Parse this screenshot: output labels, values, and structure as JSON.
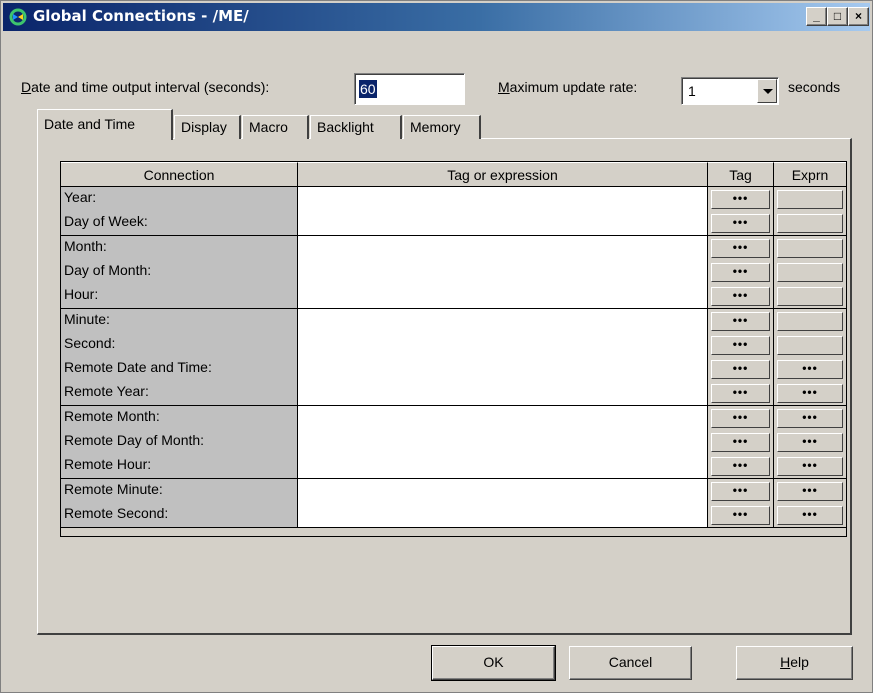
{
  "window": {
    "title": "Global Connections - /ME/",
    "minimize_glyph": "_",
    "maximize_glyph": "□",
    "close_glyph": "×"
  },
  "interval": {
    "label_key": "D",
    "label_rest": "ate and time output interval (seconds):",
    "value": "60"
  },
  "rate": {
    "label_key": "M",
    "label_rest": "aximum update rate:",
    "value": "1",
    "unit": "seconds"
  },
  "tabs": [
    {
      "label": "Date and Time",
      "active": true
    },
    {
      "label": "Display",
      "active": false
    },
    {
      "label": "Macro",
      "active": false
    },
    {
      "label": "Backlight",
      "active": false
    },
    {
      "label": "Memory",
      "active": false
    }
  ],
  "grid": {
    "headers": [
      "Connection",
      "Tag or expression",
      "Tag",
      "Exprn"
    ],
    "ellipsis": "•••",
    "rows": [
      {
        "connection": "Year:",
        "expr_button": false
      },
      {
        "connection": "Day of Week:",
        "expr_button": false
      },
      {
        "connection": "Month:",
        "expr_button": false
      },
      {
        "connection": "Day of Month:",
        "expr_button": false
      },
      {
        "connection": "Hour:",
        "expr_button": false
      },
      {
        "connection": "Minute:",
        "expr_button": false
      },
      {
        "connection": "Second:",
        "expr_button": false
      },
      {
        "connection": "Remote Date and Time:",
        "expr_button": true
      },
      {
        "connection": "Remote Year:",
        "expr_button": true
      },
      {
        "connection": "Remote Month:",
        "expr_button": true
      },
      {
        "connection": "Remote Day of Month:",
        "expr_button": true
      },
      {
        "connection": "Remote Hour:",
        "expr_button": true
      },
      {
        "connection": "Remote Minute:",
        "expr_button": true
      },
      {
        "connection": "Remote Second:",
        "expr_button": true
      }
    ]
  },
  "buttons": {
    "ok": "OK",
    "cancel": "Cancel",
    "help_key": "H",
    "help_rest": "elp"
  },
  "colors": {
    "title_gradient_start": "#0a246a",
    "title_gradient_end": "#a6caf0",
    "dialog_face": "#d4d0c8",
    "selection": "#0a246a"
  },
  "icons": [
    "app-icon",
    "minimize-icon",
    "maximize-icon",
    "close-icon",
    "dropdown-arrow-icon",
    "ellipsis-icon"
  ]
}
